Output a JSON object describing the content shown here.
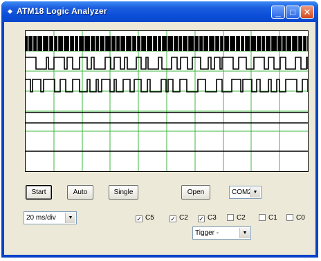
{
  "window": {
    "title": "ATM18 Logic Analyzer",
    "minimize_glyph": "_",
    "maximize_glyph": "□",
    "close_glyph": "✕",
    "icon": "app-icon"
  },
  "colors": {
    "title_bar": "#0a4dd8",
    "grid_line": "#3cb43c",
    "signal": "#000000",
    "face": "#ece9d8"
  },
  "scope": {
    "grid_columns": 10,
    "grid_rows": 7
  },
  "buttons": {
    "start": "Start",
    "auto": "Auto",
    "single": "Single",
    "open": "Open"
  },
  "port_select": {
    "value": "COM2"
  },
  "timebase_select": {
    "value": "20 ms/div"
  },
  "trigger_select": {
    "value": "Tigger -"
  },
  "channels": [
    {
      "label": "C5",
      "checked": true
    },
    {
      "label": "C2",
      "checked": true
    },
    {
      "label": "C3",
      "checked": true
    },
    {
      "label": "C2",
      "checked": false
    },
    {
      "label": "C1",
      "checked": false
    },
    {
      "label": "C0",
      "checked": false
    }
  ]
}
